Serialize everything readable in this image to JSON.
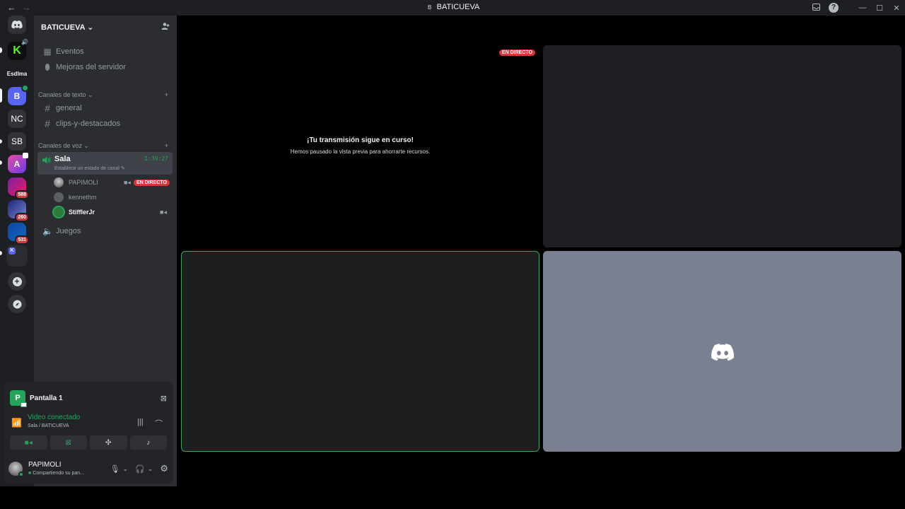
{
  "titlebar": {
    "back": "←",
    "forward": "→",
    "server_badge": "B",
    "title": "BATICUEVA"
  },
  "rail": {
    "label_esd": "EsdIma",
    "b_letter": "B",
    "nc": "NC",
    "sb": "SB",
    "count1": "588",
    "count2": "260",
    "count3": "531",
    "add": "+",
    "k": "K"
  },
  "server": {
    "name": "BATICUEVA"
  },
  "sidebar": {
    "events": "Eventos",
    "boosts": "Mejoras del servidor",
    "text_category": "Canales de texto",
    "text_channels": [
      "general",
      "clips-y-destacados"
    ],
    "voice_category": "Canales de voz",
    "voice_channel": "Sala",
    "voice_timer": "1:39:27",
    "voice_status": "Establece un estado de canal",
    "users": [
      "PAPIMOLI",
      "kennethm",
      "StifflerJr"
    ],
    "live_badge": "EN DIRECTO",
    "voice_channel_2": "Juegos"
  },
  "panel": {
    "stream_title": "Pantalla 1",
    "stream_initial": "P",
    "vc_status": "Video conectado",
    "vc_location": "Sala / BATICUEVA",
    "user_name": "PAPIMOLI",
    "user_status": "Compartiendo su pan..."
  },
  "stage": {
    "live_badge": "EN DIRECTO",
    "paused_title": "¡Tu transmisión sigue en curso!",
    "paused_text": "Hemos pausado la vista previa para ahorrarte recursos."
  },
  "colors": {
    "accent": "#5865f2",
    "green": "#23a55a",
    "red": "#da373c",
    "placeholder_tile": "#7a8092"
  }
}
